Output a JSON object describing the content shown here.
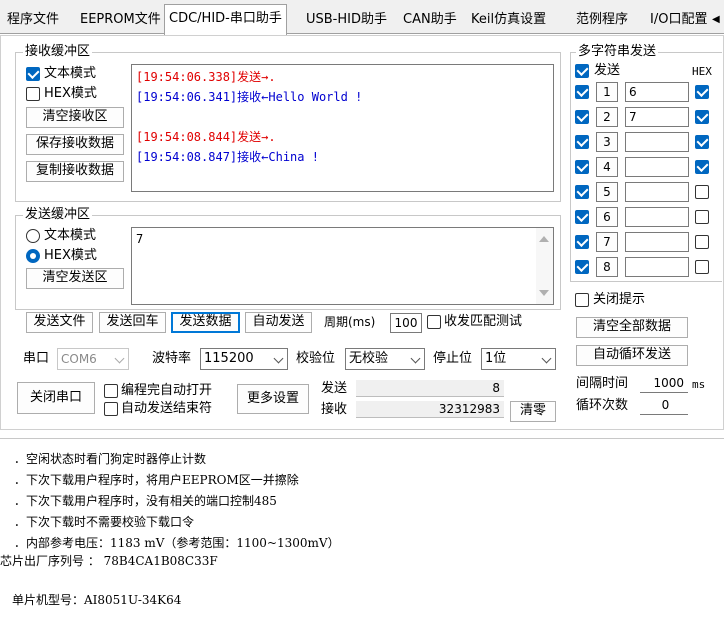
{
  "tabs": [
    {
      "label": "程序文件",
      "active": false
    },
    {
      "label": "EEPROM文件",
      "active": false
    },
    {
      "label": "CDC/HID-串口助手",
      "active": true
    },
    {
      "label": "USB-HID助手",
      "active": false
    },
    {
      "label": "CAN助手",
      "active": false
    },
    {
      "label": "Keil仿真设置",
      "active": false
    },
    {
      "label": "范例程序",
      "active": false
    },
    {
      "label": "I/O口配置",
      "active": false
    }
  ],
  "receive": {
    "title": "接收缓冲区",
    "text_mode_label": "文本模式",
    "hex_mode_label": "HEX模式",
    "clear_label": "清空接收区",
    "save_label": "保存接收数据",
    "copy_label": "复制接收数据",
    "lines": [
      {
        "text": "[19:54:06.338]发送→.",
        "kind": "send"
      },
      {
        "text": "[19:54:06.341]接收←Hello World !",
        "kind": "recv"
      },
      {
        "text": "",
        "kind": "blank"
      },
      {
        "text": "[19:54:08.844]发送→.",
        "kind": "send"
      },
      {
        "text": "[19:54:08.847]接收←China !",
        "kind": "recv"
      }
    ]
  },
  "send": {
    "title": "发送缓冲区",
    "text_mode_label": "文本模式",
    "hex_mode_label": "HEX模式",
    "clear_label": "清空发送区",
    "content": "7"
  },
  "actions": {
    "send_file": "发送文件",
    "send_return": "发送回车",
    "send_data": "发送数据",
    "auto_send": "自动发送",
    "period_label": "周期(ms)",
    "period_value": "100",
    "match_test": "收发匹配测试"
  },
  "port": {
    "port_label": "串口",
    "port_value": "COM6",
    "baud_label": "波特率",
    "baud_value": "115200",
    "parity_label": "校验位",
    "parity_value": "无校验",
    "stop_label": "停止位",
    "stop_value": "1位",
    "close_port": "关闭串口",
    "auto_open": "编程完自动打开",
    "auto_end": "自动发送结束符",
    "more_settings": "更多设置",
    "sent_label": "发送",
    "sent_value": "8",
    "recv_label": "接收",
    "recv_value": "32312983",
    "clear_counter": "清零"
  },
  "multi": {
    "title": "多字符串发送",
    "send_header": "发送",
    "hex_header": "HEX",
    "rows": [
      {
        "num": "1",
        "value": "6",
        "send": true,
        "hex": true
      },
      {
        "num": "2",
        "value": "7",
        "send": true,
        "hex": true
      },
      {
        "num": "3",
        "value": "",
        "send": true,
        "hex": true
      },
      {
        "num": "4",
        "value": "",
        "send": true,
        "hex": true
      },
      {
        "num": "5",
        "value": "",
        "send": true,
        "hex": false
      },
      {
        "num": "6",
        "value": "",
        "send": true,
        "hex": false
      },
      {
        "num": "7",
        "value": "",
        "send": true,
        "hex": false
      },
      {
        "num": "8",
        "value": "",
        "send": true,
        "hex": false
      }
    ],
    "close_hint": "关闭提示",
    "clear_all": "清空全部数据",
    "auto_loop": "自动循环发送",
    "interval_label": "间隔时间",
    "interval_value": "1000",
    "interval_unit": "ms",
    "loop_label": "循环次数",
    "loop_value": "0"
  },
  "log": [
    "．空闲状态时看门狗定时器停止计数",
    "．下次下载用户程序时，将用户EEPROM区一并擦除",
    "．下次下载用户程序时，没有相关的端口控制485",
    "．下次下载时不需要校验下载口令",
    "．内部参考电压：1183 mV（参考范围：1100~1300mV）",
    "芯片出厂序列号 ： 78B4CA1B08C33F",
    "",
    "单片机型号：AI8051U-34K64"
  ],
  "colors": {
    "accent": "#0067c0",
    "send_text": "#e00000",
    "recv_text": "#0000d0"
  }
}
